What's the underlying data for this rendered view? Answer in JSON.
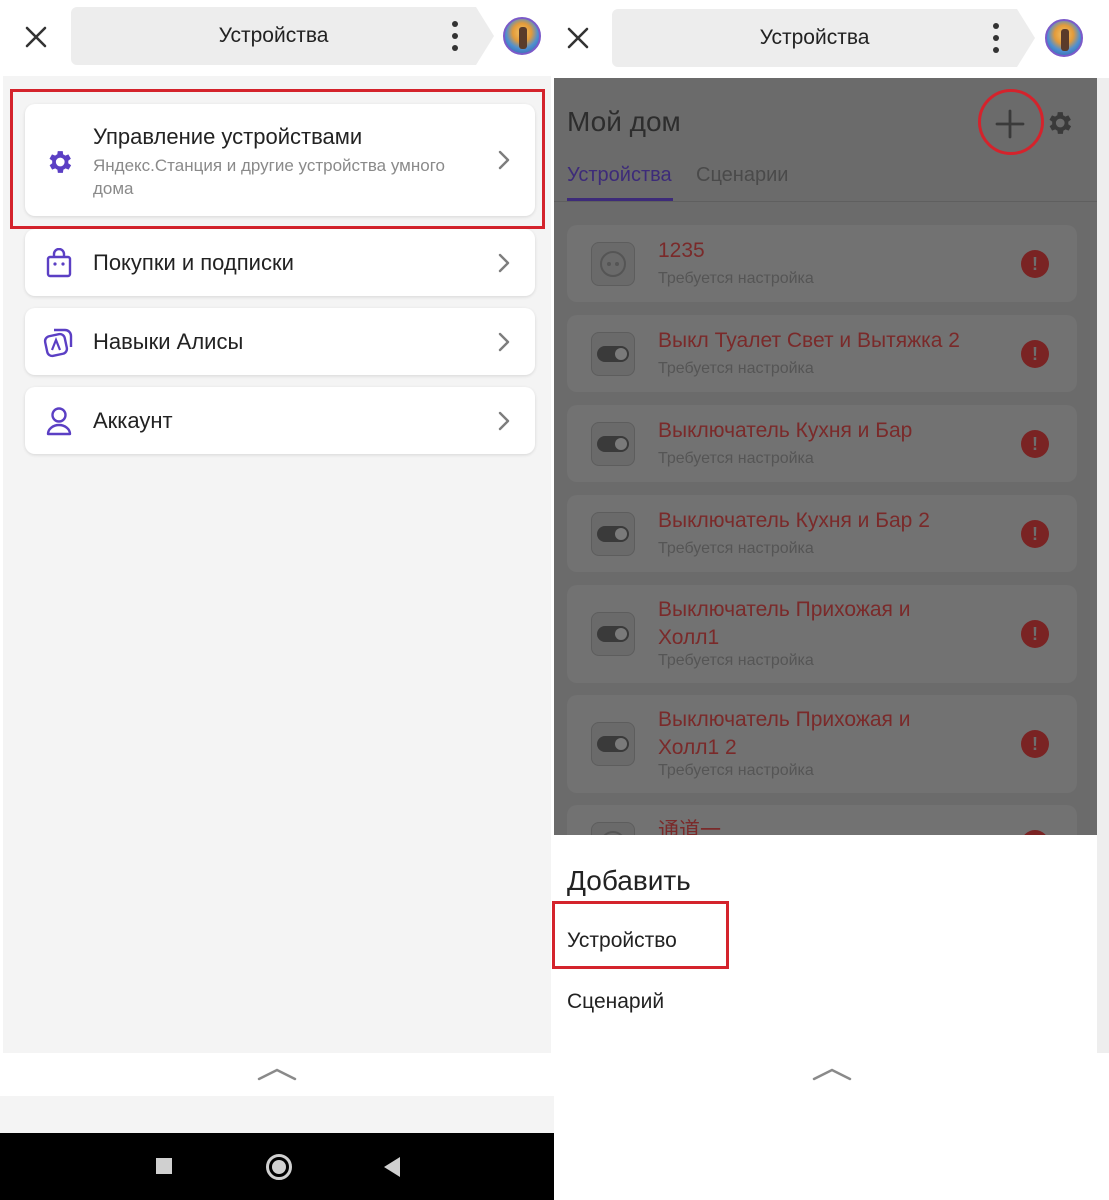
{
  "left": {
    "header": {
      "title": "Устройства"
    },
    "menu": [
      {
        "label": "Управление устройствами",
        "sub": "Яндекс.Станция и другие устройства умного дома",
        "icon": "gear-icon"
      },
      {
        "label": "Покупки и подписки",
        "icon": "shopping-bag-icon"
      },
      {
        "label": "Навыки Алисы",
        "icon": "alice-skills-icon"
      },
      {
        "label": "Аккаунт",
        "icon": "account-icon"
      }
    ]
  },
  "right": {
    "header": {
      "title": "Устройства"
    },
    "home": {
      "title": "Мой дом",
      "tabs": [
        "Устройства",
        "Сценарии"
      ],
      "devices": [
        {
          "name": "1235",
          "status": "Требуется настройка",
          "icon": "socket-icon"
        },
        {
          "name": "Выкл Туалет Свет и Вытяжка 2",
          "status": "Требуется настройка",
          "icon": "switch-icon"
        },
        {
          "name": "Выключатель Кухня и Бар",
          "status": "Требуется настройка",
          "icon": "switch-icon"
        },
        {
          "name": "Выключатель Кухня и Бар 2",
          "status": "Требуется настройка",
          "icon": "switch-icon"
        },
        {
          "name": "Выключатель Прихожая и Холл1",
          "status": "Требуется настройка",
          "icon": "switch-icon"
        },
        {
          "name": "Выключатель Прихожая и Холл1 2",
          "status": "Требуется настройка",
          "icon": "switch-icon"
        },
        {
          "name": "通道一",
          "status": "",
          "icon": "socket-icon"
        }
      ]
    },
    "add_sheet": {
      "title": "Добавить",
      "items": [
        "Устройство",
        "Сценарий"
      ]
    }
  },
  "colors": {
    "accent": "#5b3fc4",
    "highlight": "#d4232c",
    "overlay": "#6b6b6b"
  }
}
